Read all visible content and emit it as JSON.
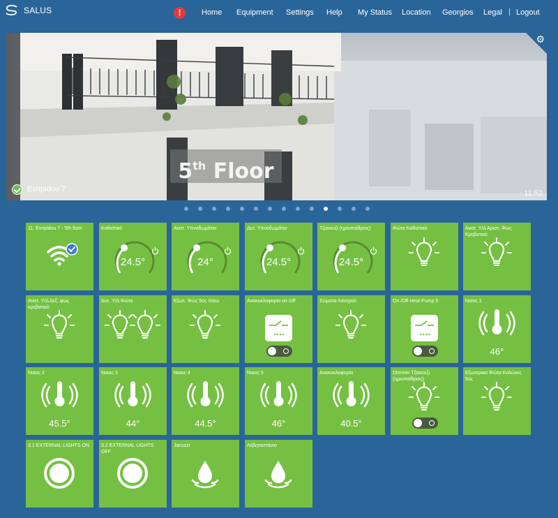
{
  "app": {
    "name": "SALUS"
  },
  "nav": {
    "alert": "!",
    "links": [
      "Home",
      "Equipment",
      "Settings",
      "Help",
      "My Status",
      "Location",
      "Georgios",
      "Legal"
    ],
    "separator": "|",
    "logout": "Logout"
  },
  "hero": {
    "floor_number": "5",
    "floor_suffix": "th",
    "floor_word": "Floor",
    "location": "Evripidou 7",
    "time": "11:52"
  },
  "carousel": {
    "count": 14,
    "active_index": 10
  },
  "tiles": [
    {
      "title": "11. Evripidou 7 - 5th floor",
      "icon": "wifi-check-icon"
    },
    {
      "title": "Καθιστικό",
      "icon": "thermostat-dial-icon",
      "value": "24.5°",
      "power_icon": "power-icon"
    },
    {
      "title": "Ανατ. Υπνοδωμάτιο",
      "icon": "thermostat-dial-icon",
      "value": "24°",
      "power_icon": "power-icon"
    },
    {
      "title": "Δυτ. Υπνοδωμάτιο",
      "icon": "thermostat-dial-icon",
      "value": "24.5°",
      "power_icon": "power-icon"
    },
    {
      "title": "Τζακουζι (ημιυπαίθριος)",
      "icon": "thermostat-dial-icon",
      "value": "24.5°",
      "power_icon": "power-icon"
    },
    {
      "title": "Φώτα Καθιστικό",
      "icon": "lightbulb-icon"
    },
    {
      "title": "Ανατ. Υ/Δ Αριστ. Φως Κρεβατιού",
      "icon": "lightbulb-icon"
    },
    {
      "title": "Ανατ. Υ/Δ Δεξ. φως κρεβατιού",
      "icon": "lightbulb-icon"
    },
    {
      "title": "Δυτ. Υ/Δ Φώτα",
      "icon": "double-lightbulb-icon"
    },
    {
      "title": "Εξωτ. Φώς 5ος πίσω",
      "icon": "lightbulb-icon"
    },
    {
      "title": "Ανακυκλοφορία on /off",
      "icon": "relay-switch-icon",
      "toggle": "off"
    },
    {
      "title": "Σώματα Λουτρού",
      "icon": "lightbulb-icon"
    },
    {
      "title": "On /Off Heat Pump 5",
      "icon": "relay-switch-icon",
      "toggle": "off"
    },
    {
      "title": "Νιαος 1",
      "icon": "temperature-sensor-icon",
      "value": "46°"
    },
    {
      "title": "Νιαος 2",
      "icon": "temperature-sensor-icon",
      "value": "45.5°"
    },
    {
      "title": "Νιαος 3",
      "icon": "temperature-sensor-icon",
      "value": "44°"
    },
    {
      "title": "Νιαος 4",
      "icon": "temperature-sensor-icon",
      "value": "44.5°"
    },
    {
      "title": "Νιαος 5",
      "icon": "temperature-sensor-icon",
      "value": "46°"
    },
    {
      "title": "Ανακυκλοφορία",
      "icon": "temperature-sensor-icon",
      "value": "40.5°"
    },
    {
      "title": "Dimmer Τζακουζι (ημιυπαίθριος)",
      "icon": "lightbulb-icon",
      "toggle": "off"
    },
    {
      "title": "Εξωτερικα Φώτα Κολώνες 5ος",
      "icon": "lightbulb-icon"
    },
    {
      "title": "3.1 EXTERNAL LIGHTS ON",
      "icon": "round-button-icon"
    },
    {
      "title": "3.2 EXTERNAL LIGHTS OFF",
      "icon": "round-button-icon"
    },
    {
      "title": "Jacuzzi",
      "icon": "water-drop-icon"
    },
    {
      "title": "Λεβητοστάσιο",
      "icon": "water-drop-icon"
    }
  ],
  "colors": {
    "background": "#2a659a",
    "tile": "#75c043",
    "alert": "#e03c3c",
    "check": "#6cc24a",
    "wifi_badge": "#3b7bd6"
  }
}
